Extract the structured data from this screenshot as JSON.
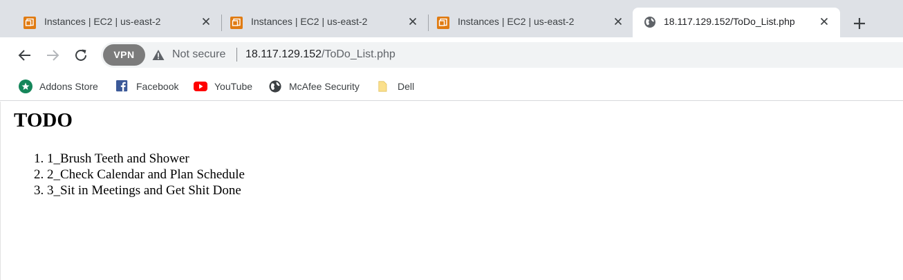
{
  "tabs": [
    {
      "title": "Instances | EC2 | us-east-2",
      "favicon": "aws-ec2-icon",
      "active": false
    },
    {
      "title": "Instances | EC2 | us-east-2",
      "favicon": "aws-ec2-icon",
      "active": false
    },
    {
      "title": "Instances | EC2 | us-east-2",
      "favicon": "aws-ec2-icon",
      "active": false
    },
    {
      "title": "18.117.129.152/ToDo_List.php",
      "favicon": "globe-icon",
      "active": true
    }
  ],
  "toolbar": {
    "vpn_label": "VPN",
    "security_label": "Not secure",
    "url_host": "18.117.129.152",
    "url_path": "/ToDo_List.php"
  },
  "bookmarks": [
    {
      "label": "Addons Store",
      "icon": "addons-store-icon"
    },
    {
      "label": "Facebook",
      "icon": "facebook-icon"
    },
    {
      "label": "YouTube",
      "icon": "youtube-icon"
    },
    {
      "label": "McAfee Security",
      "icon": "mcafee-globe-icon"
    },
    {
      "label": "Dell",
      "icon": "folder-icon"
    }
  ],
  "page": {
    "heading": "TODO",
    "items": [
      "1. 1_Brush Teeth and Shower",
      "2. 2_Check Calendar and Plan Schedule",
      "3. 3_Sit in Meetings and Get Shit Done"
    ]
  },
  "colors": {
    "tabstrip_bg": "#dee1e6",
    "omnibox_bg": "#f1f3f4",
    "aws_orange": "#e07b12",
    "facebook_blue": "#3b5998",
    "youtube_red": "#ff0000",
    "addons_green": "#15865a"
  }
}
